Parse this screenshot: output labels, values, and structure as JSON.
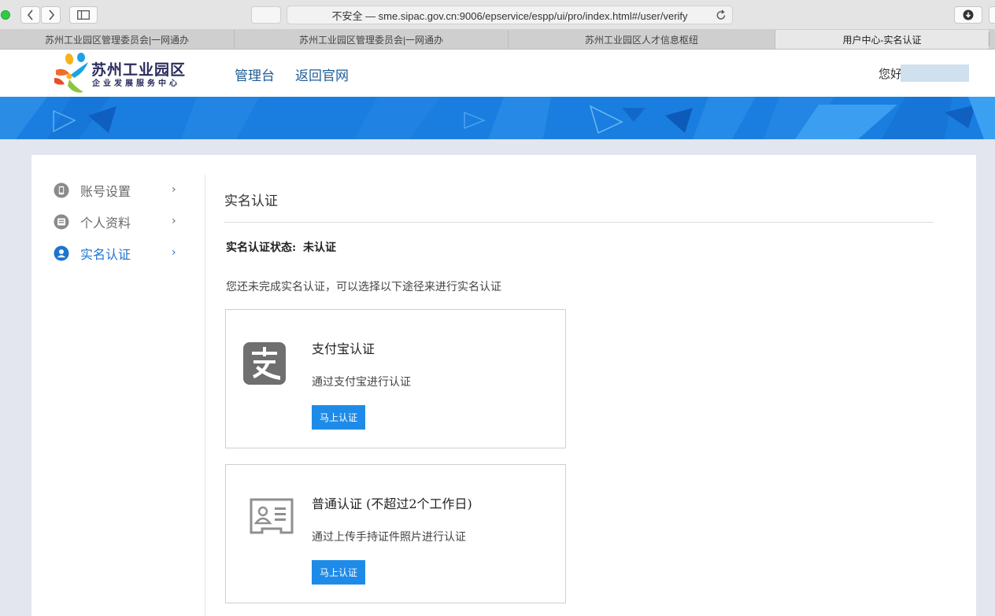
{
  "browser": {
    "address": "不安全 — sme.sipac.gov.cn:9006/epservice/espp/ui/pro/index.html#/user/verify",
    "tabs": [
      {
        "label": "苏州工业园区管理委员会|一网通办"
      },
      {
        "label": "苏州工业园区管理委员会|一网通办"
      },
      {
        "label": "苏州工业园区人才信息枢纽"
      },
      {
        "label": "用户中心-实名认证"
      }
    ]
  },
  "header": {
    "logo_title": "苏州工业园区",
    "logo_subtitle": "企业发展服务中心",
    "nav": [
      "管理台",
      "返回官网"
    ],
    "greeting": "您好"
  },
  "sidebar": {
    "items": [
      {
        "label": "账号设置",
        "icon": "phone-icon"
      },
      {
        "label": "个人资料",
        "icon": "profile-icon"
      },
      {
        "label": "实名认证",
        "icon": "user-icon",
        "active": true
      }
    ]
  },
  "content": {
    "title": "实名认证",
    "status_label": "实名认证状态:",
    "status_value": "未认证",
    "intro": "您还未完成实名认证，可以选择以下途径来进行实名认证",
    "methods": [
      {
        "title": "支付宝认证",
        "desc": "通过支付宝进行认证",
        "button": "马上认证",
        "icon": "alipay-icon"
      },
      {
        "title": "普通认证 (不超过2个工作日)",
        "desc": "通过上传手持证件照片进行认证",
        "button": "马上认证",
        "icon": "id-card-icon"
      }
    ]
  },
  "colors": {
    "accent": "#1f8be8",
    "nav_link": "#1e5d96",
    "banner": "#1a7ee0",
    "page_bg": "#e3e5ef"
  }
}
